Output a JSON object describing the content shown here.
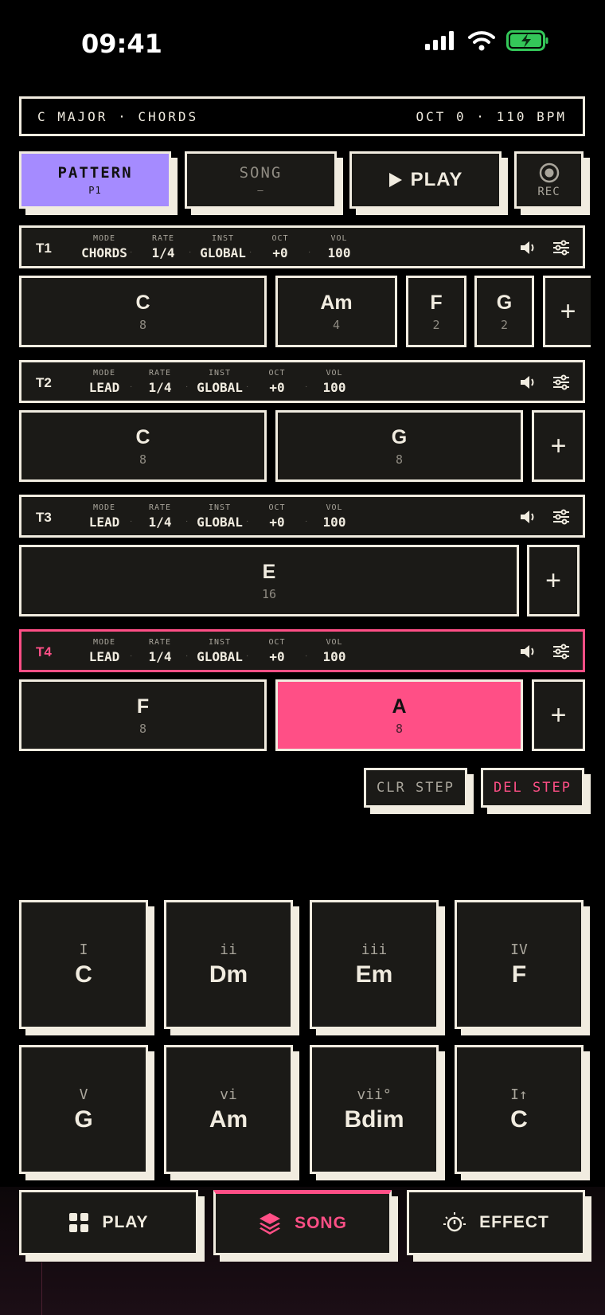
{
  "status_bar": {
    "time": "09:41"
  },
  "header": {
    "left": "C MAJOR · CHORDS",
    "right": "OCT 0 · 110 BPM"
  },
  "top_buttons": {
    "pattern": {
      "label": "PATTERN",
      "sub": "P1"
    },
    "song": {
      "label": "SONG",
      "sub": "—"
    },
    "play": {
      "label": "PLAY"
    },
    "rec": {
      "label": "REC"
    }
  },
  "param_labels": {
    "mode": "MODE",
    "rate": "RATE",
    "inst": "INST",
    "oct": "OCT",
    "vol": "VOL"
  },
  "tracks": [
    {
      "id": "T1",
      "mode": "CHORDS",
      "rate": "1/4",
      "inst": "GLOBAL",
      "oct": "+0",
      "vol": "100",
      "steps": [
        {
          "name": "C",
          "len": "8"
        },
        {
          "name": "Am",
          "len": "4"
        },
        {
          "name": "F",
          "len": "2"
        },
        {
          "name": "G",
          "len": "2"
        }
      ]
    },
    {
      "id": "T2",
      "mode": "LEAD",
      "rate": "1/4",
      "inst": "GLOBAL",
      "oct": "+0",
      "vol": "100",
      "steps": [
        {
          "name": "C",
          "len": "8"
        },
        {
          "name": "G",
          "len": "8"
        }
      ]
    },
    {
      "id": "T3",
      "mode": "LEAD",
      "rate": "1/4",
      "inst": "GLOBAL",
      "oct": "+0",
      "vol": "100",
      "steps": [
        {
          "name": "E",
          "len": "16"
        }
      ]
    },
    {
      "id": "T4",
      "mode": "LEAD",
      "rate": "1/4",
      "inst": "GLOBAL",
      "oct": "+0",
      "vol": "100",
      "steps": [
        {
          "name": "F",
          "len": "8"
        },
        {
          "name": "A",
          "len": "8"
        }
      ]
    }
  ],
  "step_actions": {
    "clear": "CLR STEP",
    "delete": "DEL STEP"
  },
  "pads": [
    {
      "degree": "I",
      "chord": "C"
    },
    {
      "degree": "ii",
      "chord": "Dm"
    },
    {
      "degree": "iii",
      "chord": "Em"
    },
    {
      "degree": "IV",
      "chord": "F"
    },
    {
      "degree": "V",
      "chord": "G"
    },
    {
      "degree": "vi",
      "chord": "Am"
    },
    {
      "degree": "vii°",
      "chord": "Bdim"
    },
    {
      "degree": "I↑",
      "chord": "C"
    }
  ],
  "nav": {
    "play": "PLAY",
    "song": "SONG",
    "effect": "EFFECT"
  },
  "colors": {
    "accent": "#ff4f86",
    "pattern_active": "#a58bff",
    "ink": "#f1ece0",
    "panel": "#1b1a17",
    "battery": "#34c759"
  }
}
